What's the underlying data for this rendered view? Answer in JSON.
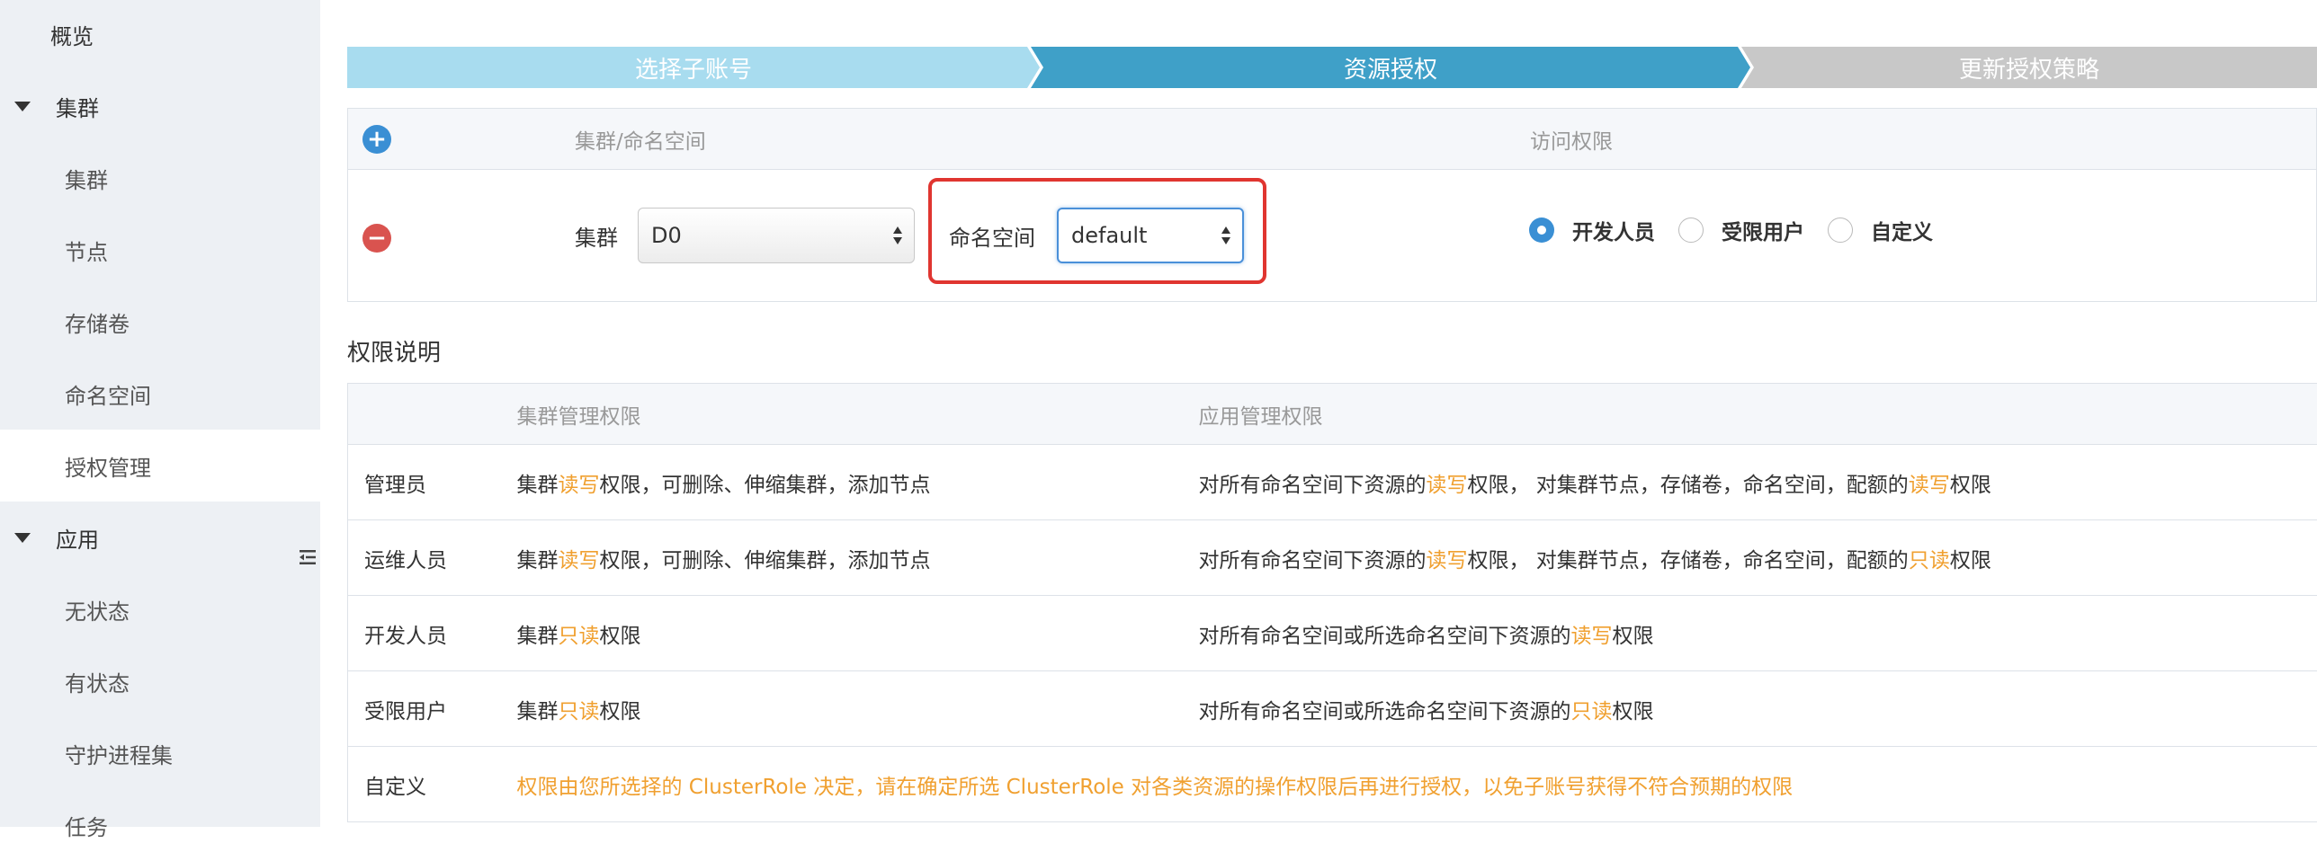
{
  "sidebar": {
    "overview": "概览",
    "cluster_group": "集群",
    "cluster_items": [
      "集群",
      "节点",
      "存储卷",
      "命名空间",
      "授权管理"
    ],
    "app_group": "应用",
    "app_items": [
      "无状态",
      "有状态",
      "守护进程集",
      "任务"
    ],
    "active_item": "授权管理"
  },
  "steps": [
    "选择子账号",
    "资源授权",
    "更新授权策略"
  ],
  "grant": {
    "col_cluster_ns": "集群/命名空间",
    "col_access": "访问权限",
    "cluster_label": "集群",
    "cluster_value": "D0",
    "namespace_label": "命名空间",
    "namespace_value": "default",
    "roles": [
      "开发人员",
      "受限用户",
      "自定义"
    ],
    "selected_role": "开发人员"
  },
  "permissions": {
    "title": "权限说明",
    "headers": [
      "",
      "集群管理权限",
      "应用管理权限"
    ],
    "rows": [
      {
        "role": "管理员",
        "cluster": [
          "集群",
          "读写",
          "权限，可删除、伸缩集群，添加节点"
        ],
        "app": [
          "对所有命名空间下资源的",
          "读写",
          "权限，  对集群节点，存储卷，命名空间，配额的",
          "读写",
          "权限"
        ]
      },
      {
        "role": "运维人员",
        "cluster": [
          "集群",
          "读写",
          "权限，可删除、伸缩集群，添加节点"
        ],
        "app": [
          "对所有命名空间下资源的",
          "读写",
          "权限，  对集群节点，存储卷，命名空间，配额的",
          "只读",
          "权限"
        ]
      },
      {
        "role": "开发人员",
        "cluster": [
          "集群",
          "只读",
          "权限"
        ],
        "app": [
          "对所有命名空间或所选命名空间下资源的",
          "读写",
          "权限"
        ]
      },
      {
        "role": "受限用户",
        "cluster": [
          "集群",
          "只读",
          "权限"
        ],
        "app": [
          "对所有命名空间或所选命名空间下资源的",
          "只读",
          "权限"
        ]
      }
    ],
    "custom_role": "自定义",
    "custom_note": "权限由您所选择的 ClusterRole 决定，请在确定所选 ClusterRole 对各类资源的操作权限后再进行授权，以免子账号获得不符合预期的权限"
  },
  "colors": {
    "step1": "#a8dcef",
    "step2": "#3fa0c8",
    "step3": "#c8c8c8",
    "accent": "#3a8fd4",
    "danger": "#d9534f",
    "highlight": "#f0a030"
  }
}
